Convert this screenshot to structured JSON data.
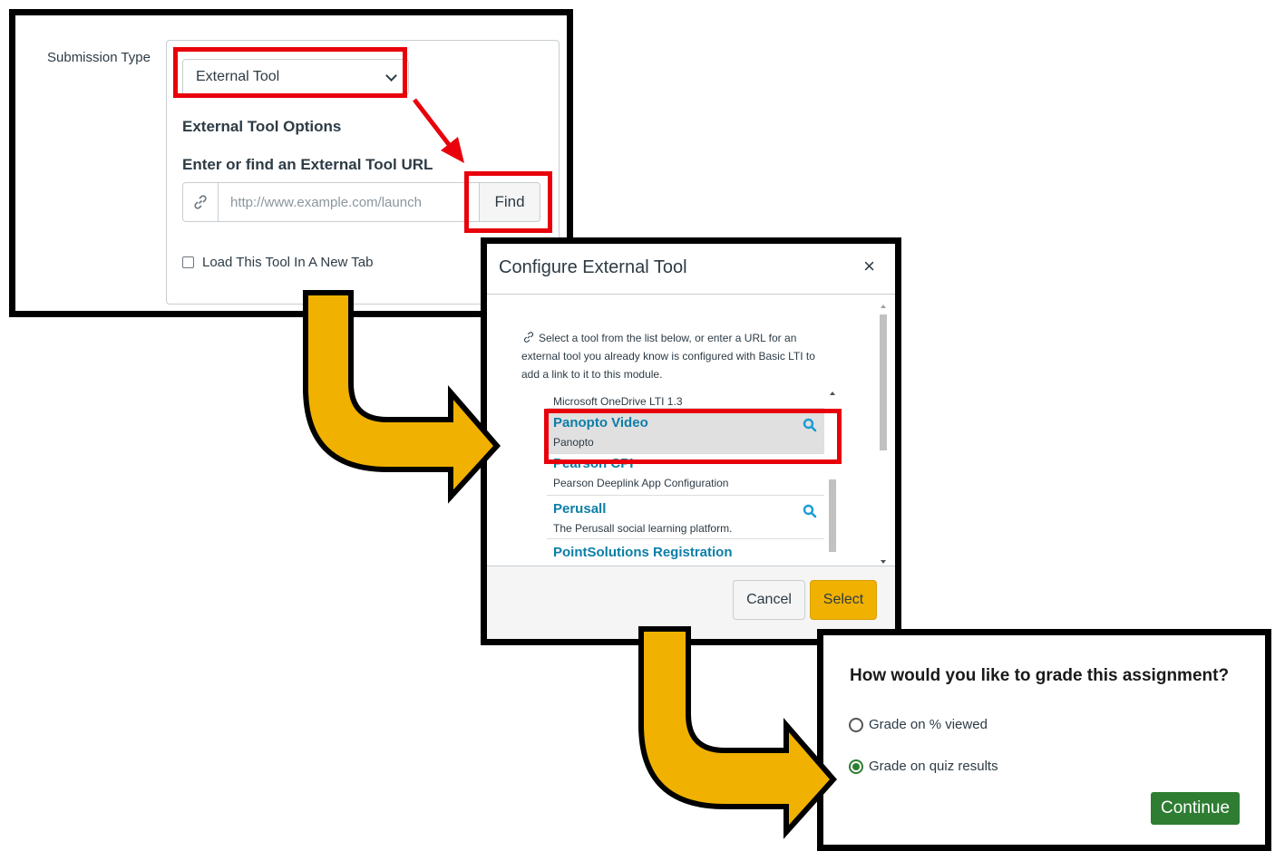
{
  "submission": {
    "label": "Submission Type",
    "selected": "External Tool",
    "options_title": "External Tool Options",
    "url_title": "Enter or find an External Tool URL",
    "url_placeholder": "http://www.example.com/launch",
    "find_label": "Find",
    "new_tab_label": "Load This Tool In A New Tab"
  },
  "modal": {
    "title": "Configure External Tool",
    "close_glyph": "×",
    "intro": "Select a tool from the list below, or enter a URL for an external tool you already know is configured with Basic LTI to add a link to it to this module.",
    "items": [
      {
        "name": "Microsoft OneDrive LTI 1.3",
        "desc": ""
      },
      {
        "name": "Panopto Video",
        "desc": "Panopto",
        "selected": true,
        "search_icon": true
      },
      {
        "name": "Pearson CPI",
        "desc": "Pearson Deeplink App Configuration"
      },
      {
        "name": "Perusall",
        "desc": "The Perusall social learning platform.",
        "search_icon": true
      },
      {
        "name": "PointSolutions Registration",
        "desc": ""
      }
    ],
    "cancel_label": "Cancel",
    "select_label": "Select"
  },
  "grade": {
    "question": "How would you like to grade this assignment?",
    "options": [
      {
        "label": "Grade on % viewed",
        "checked": false
      },
      {
        "label": "Grade on quiz results",
        "checked": true
      }
    ],
    "continue_label": "Continue"
  },
  "colors": {
    "highlight_red": "#e8000b",
    "arrow_gold": "#f0b100",
    "link_teal": "#0b7ea8",
    "continue_green": "#2e7d32"
  }
}
